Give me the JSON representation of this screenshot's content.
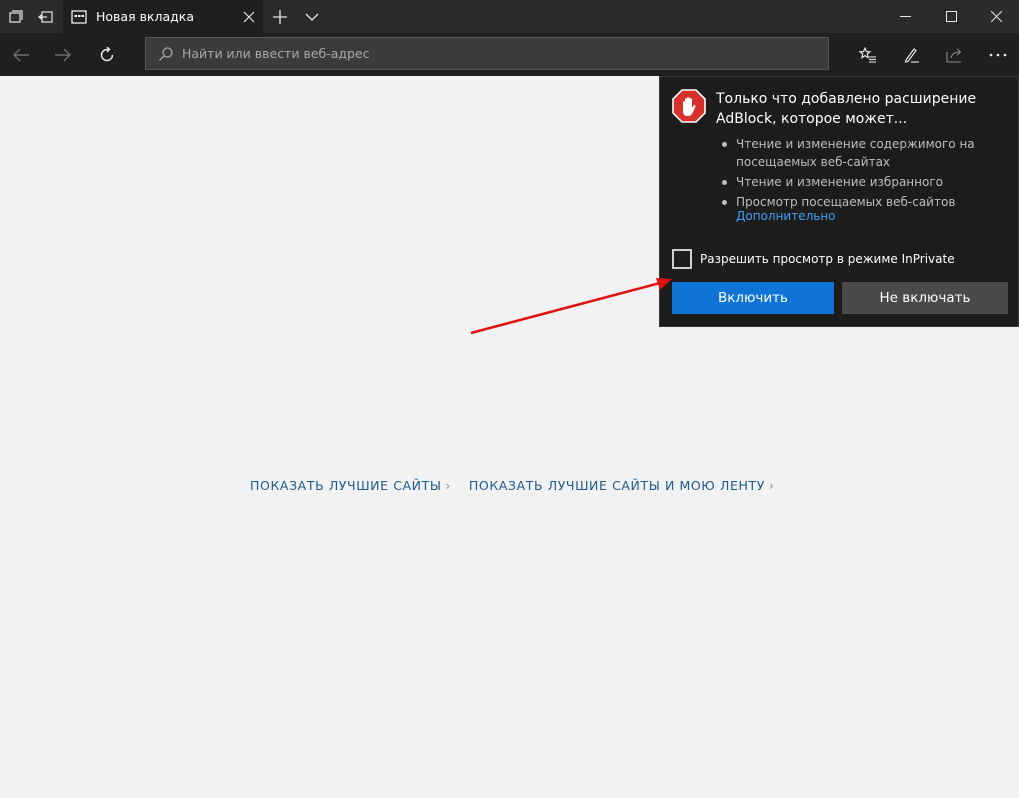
{
  "tab": {
    "title": "Новая вкладка"
  },
  "address_bar": {
    "placeholder": "Найти или ввести веб-адрес"
  },
  "new_tab_page": {
    "links": [
      {
        "label": "ПОКАЗАТЬ ЛУЧШИЕ САЙТЫ"
      },
      {
        "label": "ПОКАЗАТЬ ЛУЧШИЕ САЙТЫ И МОЮ ЛЕНТУ"
      }
    ]
  },
  "extension_popup": {
    "title": "Только что добавлено расширение AdBlock, которое может...",
    "permissions": [
      "Чтение и изменение содержимого на посещаемых веб-сайтах",
      "Чтение и изменение избранного",
      "Просмотр посещаемых веб-сайтов"
    ],
    "more_link": "Дополнительно",
    "inprivate_checkbox_label": "Разрешить просмотр в режиме InPrivate",
    "inprivate_checked": false,
    "enable_button": "Включить",
    "cancel_button": "Не включать"
  },
  "colors": {
    "accent": "#0f74d6",
    "link": "#1d5a8f",
    "popup_link": "#3ea0f5",
    "annotation_arrow": "#e01010"
  },
  "icons": [
    "tab-preview-icon",
    "set-aside-tabs-icon",
    "favicon-icon",
    "close-tab-icon",
    "new-tab-icon",
    "tab-list-chevron-icon",
    "minimize-icon",
    "maximize-icon",
    "window-close-icon",
    "back-icon",
    "forward-icon",
    "refresh-icon",
    "search-icon",
    "favorites-icon",
    "web-note-icon",
    "share-icon",
    "more-icon",
    "adblock-hand-icon"
  ]
}
